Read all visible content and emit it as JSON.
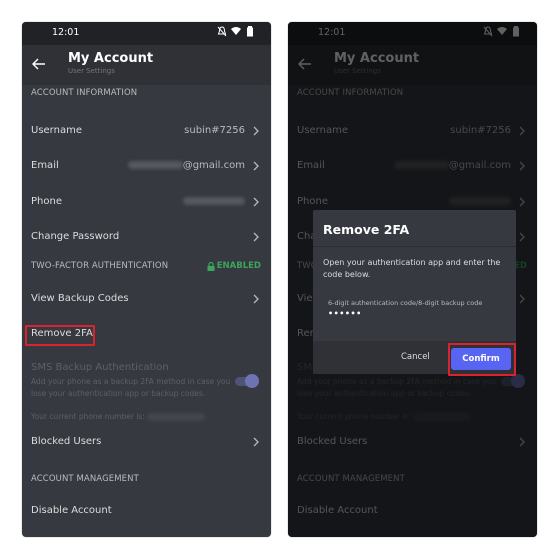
{
  "status_bar": {
    "time": "12:01",
    "icons": [
      "notifications-off-icon",
      "wifi-icon",
      "battery-icon"
    ]
  },
  "app_bar": {
    "title": "My Account",
    "subtitle": "User Settings",
    "back_icon": "arrow-left-icon"
  },
  "sections": {
    "account_information": {
      "header": "ACCOUNT INFORMATION",
      "rows": [
        {
          "label": "Username",
          "value": "subin#7256"
        },
        {
          "label": "Email",
          "value": "@gmail.com",
          "value_redacted_prefix": true
        },
        {
          "label": "Phone",
          "value": "",
          "value_redacted": true
        },
        {
          "label": "Change Password",
          "value": ""
        }
      ]
    },
    "two_factor": {
      "header": "TWO-FACTOR AUTHENTICATION",
      "status": "ENABLED",
      "rows": [
        {
          "label": "View Backup Codes"
        },
        {
          "label": "Remove 2FA"
        }
      ],
      "sms_backup": {
        "title": "SMS Backup Authentication",
        "description": "Add your phone as a backup 2FA method in case you lose your authentication app or backup codes.",
        "phone_prefix": "Your current phone number is:",
        "toggle_on": true
      }
    },
    "blocked_users": {
      "label": "Blocked Users"
    },
    "account_management": {
      "header": "ACCOUNT MANAGEMENT",
      "rows": [
        {
          "label": "Disable Account"
        }
      ]
    }
  },
  "dialog": {
    "title": "Remove 2FA",
    "body": "Open your authentication app and enter the code below.",
    "field_label": "6-digit authentication code/8-digit backup code",
    "field_value": "••••••",
    "cancel_label": "Cancel",
    "confirm_label": "Confirm"
  },
  "colors": {
    "accent": "#5865f2",
    "enabled_green": "#3ba55c",
    "highlight_red": "#d9232f",
    "background": "#36393f"
  }
}
